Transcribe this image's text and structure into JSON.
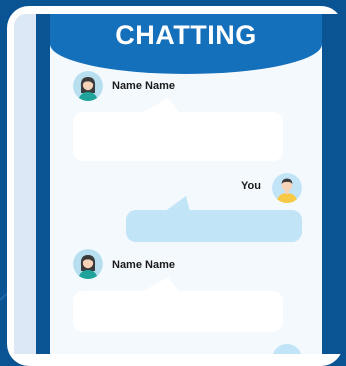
{
  "header": {
    "title": "CHATTING"
  },
  "messages": [
    {
      "sender": "Name Name",
      "side": "left",
      "avatar": "female-avatar-icon",
      "text": ""
    },
    {
      "sender": "You",
      "side": "right",
      "avatar": "male-avatar-icon",
      "text": ""
    },
    {
      "sender": "Name Name",
      "side": "left",
      "avatar": "female-avatar-icon",
      "text": ""
    }
  ],
  "colors": {
    "background": "#0a5494",
    "header": "#1570bb",
    "screen": "#f3f9fd",
    "incoming_bubble": "#ffffff",
    "outgoing_bubble": "#c2e4f7"
  }
}
